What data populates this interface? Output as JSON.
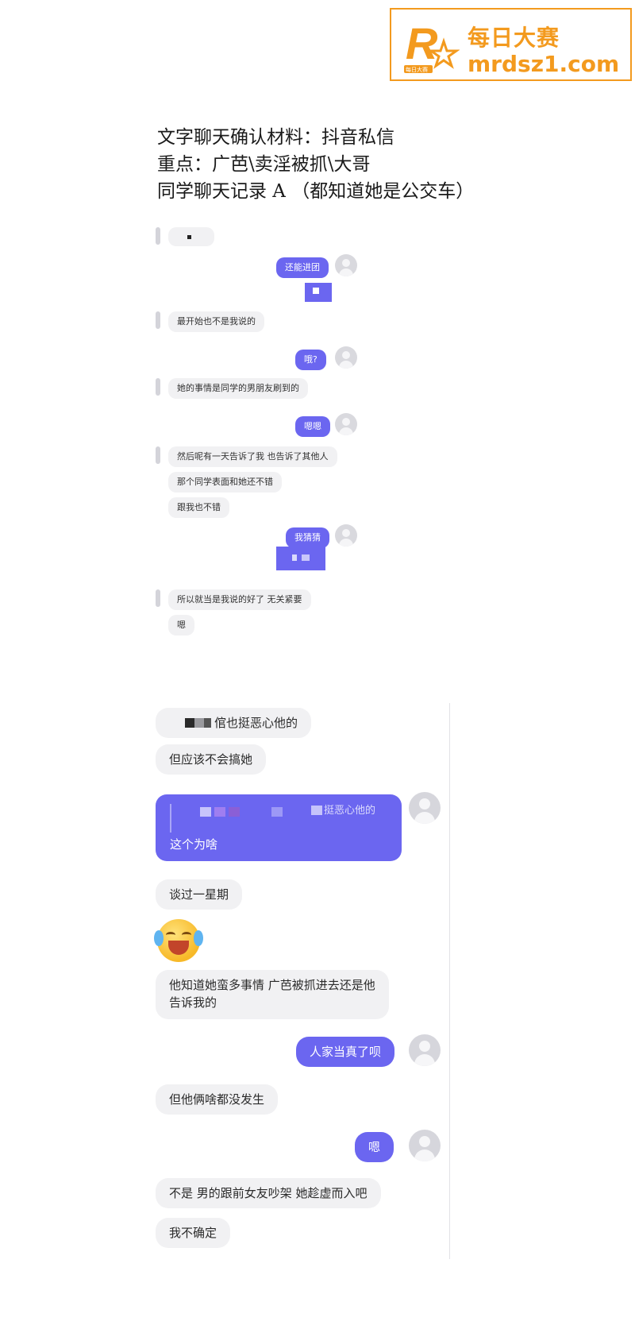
{
  "watermark": {
    "brand": "每日大赛",
    "domain": "mrdsz1.com",
    "logo_text": "每日大赛",
    "accent_color": "#f39a1e"
  },
  "header": {
    "line1": "文字聊天确认材料：抖音私信",
    "line2": "重点：广芭\\卖淫被抓\\大哥",
    "line3": "同学聊天记录 A （都知道她是公交车）"
  },
  "small_chat": {
    "messages": [
      {
        "side": "right",
        "text": "还能进团"
      },
      {
        "side": "left",
        "text": "最开始也不是我说的"
      },
      {
        "side": "right",
        "text": "哦?"
      },
      {
        "side": "left",
        "text": "她的事情是同学的男朋友刷到的"
      },
      {
        "side": "right",
        "text": "嗯嗯"
      },
      {
        "side": "left",
        "text": "然后呢有一天告诉了我 也告诉了其他人"
      },
      {
        "side": "left",
        "text": "那个同学表面和她还不错"
      },
      {
        "side": "left",
        "text": "跟我也不错"
      },
      {
        "side": "right",
        "text": "我猜猜"
      },
      {
        "side": "left",
        "text": "所以就当是我说的好了 无关紧要"
      },
      {
        "side": "left",
        "text": "嗯"
      }
    ]
  },
  "big_chat": {
    "messages": [
      {
        "side": "left",
        "text": "倌也挺恶心他的"
      },
      {
        "side": "left",
        "text": "但应该不会搞她"
      },
      {
        "side": "right",
        "quote": "挺恶心他的",
        "text": "这个为啥"
      },
      {
        "side": "left",
        "text": "谈过一星期"
      },
      {
        "side": "left",
        "text": "他知道她蛮多事情 广芭被抓进去还是他",
        "text2": "告诉我的"
      },
      {
        "side": "right",
        "text": "人家当真了呗"
      },
      {
        "side": "left",
        "text": "但他俩啥都没发生"
      },
      {
        "side": "right",
        "text": "嗯"
      },
      {
        "side": "left",
        "text": "不是 男的跟前女友吵架 她趁虚而入吧"
      },
      {
        "side": "left",
        "text": "我不确定"
      }
    ],
    "colors": {
      "bubble_right": "#6b66f0",
      "bubble_left": "#f1f1f3"
    }
  }
}
